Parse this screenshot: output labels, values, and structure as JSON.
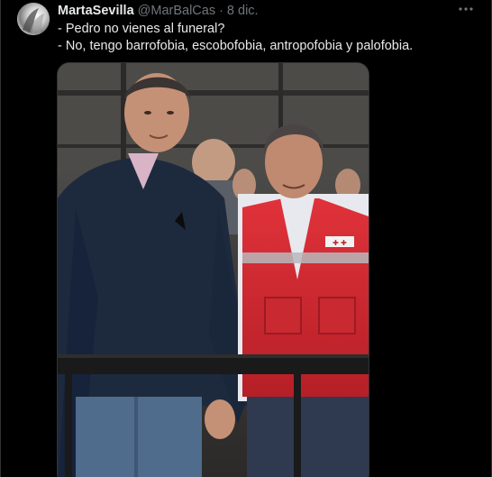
{
  "tweet": {
    "author_name": "MartaSevilla",
    "author_handle": "@MarBalCas",
    "separator": "·",
    "date": "8 dic.",
    "more_icon": "ellipsis-icon",
    "lines": [
      "- Pedro no vienes al funeral?",
      "- No, tengo barrofobia, escobofobia, antropofobia y palofobia."
    ],
    "media_alt": "photo"
  },
  "colors": {
    "background": "#000000",
    "primary_text": "#e7e9ea",
    "secondary_text": "#71767b",
    "border": "#2f3336"
  }
}
